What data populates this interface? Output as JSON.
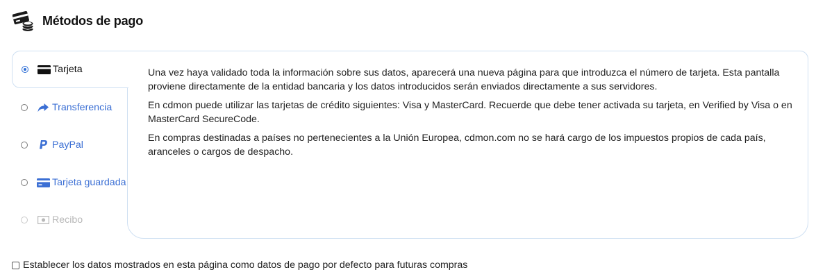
{
  "header": {
    "title": "Métodos de pago",
    "icon": "card-coins-icon"
  },
  "tabs": [
    {
      "label": "Tarjeta",
      "icon": "credit-card-icon",
      "selected": true,
      "enabled": true
    },
    {
      "label": "Transferencia",
      "icon": "share-arrow-icon",
      "selected": false,
      "enabled": true
    },
    {
      "label": "PayPal",
      "icon": "paypal-icon",
      "selected": false,
      "enabled": true
    },
    {
      "label": "Tarjeta guardada",
      "icon": "saved-card-icon",
      "selected": false,
      "enabled": true
    },
    {
      "label": "Recibo",
      "icon": "money-bill-icon",
      "selected": false,
      "enabled": false
    }
  ],
  "panel": {
    "paragraphs": [
      "Una vez haya validado toda la información sobre sus datos, aparecerá una nueva página para que introduzca el número de tarjeta. Esta pantalla proviene directamente de la entidad bancaria y los datos introducidos serán enviados directamente a sus servidores.",
      "En cdmon puede utilizar las tarjetas de crédito siguientes: Visa y MasterCard. Recuerde que debe tener activada su tarjeta, en Verified by Visa o en MasterCard SecureCode.",
      "En compras destinadas a países no pertenecientes a la Unión Europea, cdmon.com no se hará cargo de los impuestos propios de cada país, aranceles o cargos de despacho."
    ]
  },
  "default_option": {
    "label": "Establecer los datos mostrados en esta página como datos de pago por defecto para futuras compras",
    "checked": false
  },
  "colors": {
    "accent": "#3b6fd4",
    "border": "#cfe0f2",
    "disabled": "#b8b8b8"
  }
}
